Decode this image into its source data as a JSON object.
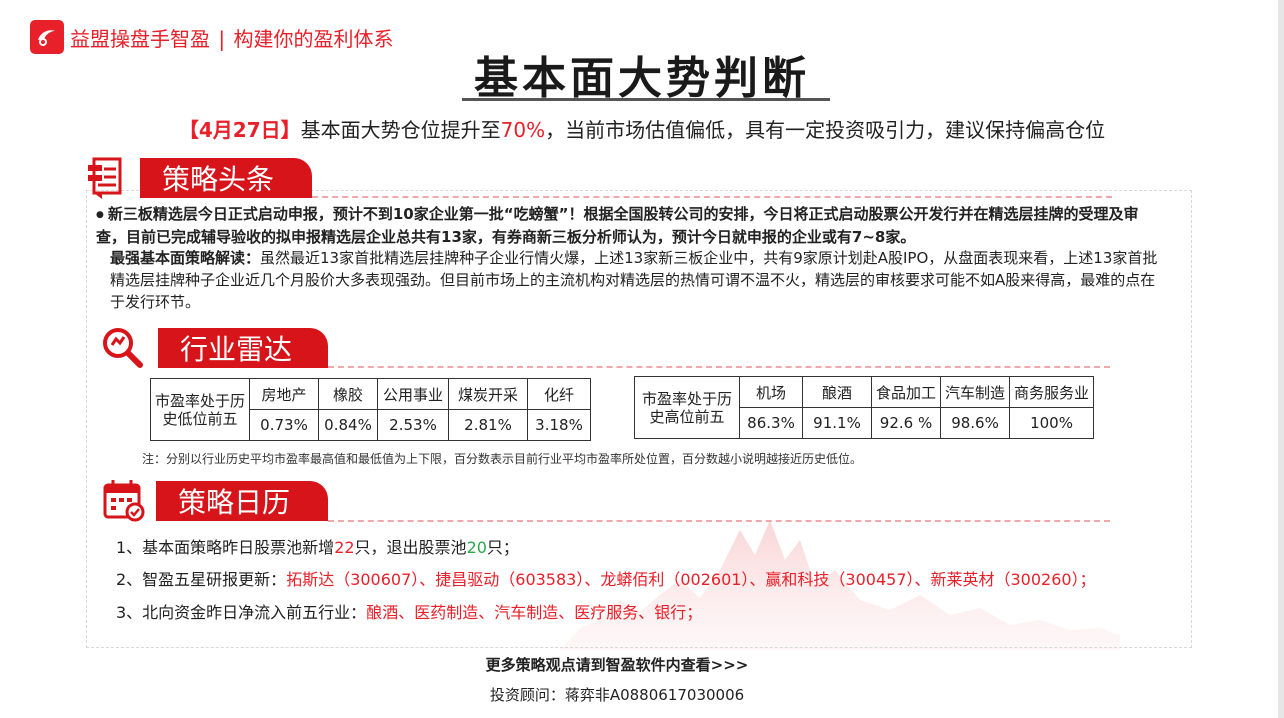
{
  "brand": {
    "name": "益盟操盘手智盈",
    "separator": "|",
    "slogan": "构建你的盈利体系",
    "color": "#e8202a"
  },
  "title": "基本面大势判断",
  "headline": {
    "date": "【4月27日】",
    "text_before": "基本面大势仓位提升至",
    "percent": "70%",
    "text_after": "，当前市场估值偏低，具有一定投资吸引力，建议保持偏高仓位"
  },
  "strategy": {
    "tab_label": "策略头条",
    "icon": "document-icon",
    "bullet": "●",
    "lead": "新三板精选层今日正式启动申报，预计不到10家企业第一批“吃螃蟹”！根据全国股转公司的安排，今日将正式启动股票公开发行并在精选层挂牌的受理及审查，目前已完成辅导验收的拟申报精选层企业总共有13家，有券商新三板分析师认为，预计今日就申报的企业或有7~8家。",
    "analysis_label": "最强基本面策略解读：",
    "analysis": "虽然最近13家首批精选层挂牌种子企业行情火爆，上述13家新三板企业中，共有9家原计划赴A股IPO，从盘面表现来看，上述13家首批精选层挂牌种子企业近几个月股价大多表现强劲。但目前市场上的主流机构对精选层的热情可谓不温不火，精选层的审核要求可能不如A股来得高，最难的点在于发行环节。"
  },
  "radar": {
    "tab_label": "行业雷达",
    "icon": "magnifier-icon",
    "low": {
      "header": "市盈率处于历史低位前五",
      "industries": [
        "房地产",
        "橡胶",
        "公用事业",
        "煤炭开采",
        "化纤"
      ],
      "values": [
        "0.73%",
        "0.84%",
        "2.53%",
        "2.81%",
        "3.18%"
      ]
    },
    "high": {
      "header": "市盈率处于历史高位前五",
      "industries": [
        "机场",
        "酿酒",
        "食品加工",
        "汽车制造",
        "商务服务业"
      ],
      "values": [
        "86.3%",
        "91.1%",
        "92.6 %",
        "98.6%",
        "100%"
      ]
    },
    "note": "注：分别以行业历史平均市盈率最高值和最低值为上下限，百分数表示目前行业平均市盈率所处位置，百分数越小说明越接近历史低位。"
  },
  "calendar": {
    "tab_label": "策略日历",
    "icon": "calendar-icon",
    "item1": {
      "prefix": "1、基本面策略昨日股票池新增",
      "added": "22",
      "mid": "只，退出股票池",
      "removed": "20",
      "suffix": "只；"
    },
    "item2": {
      "prefix": "2、智盈五星研报更新：",
      "stocks": "拓斯达（300607）、捷昌驱动（603583）、龙蟒佰利（002601）、赢和科技（300457）、新莱英材（300260）；"
    },
    "item3": {
      "prefix": "3、北向资金昨日净流入前五行业：",
      "industries": "酿酒、医药制造、汽车制造、医疗服务、银行；"
    }
  },
  "footer": {
    "more": "更多策略观点请到智盈软件内查看>>>",
    "advisor": "投资顾问：蒋弈非A0880617030006"
  },
  "colors": {
    "accent": "#d7141a",
    "green": "#2aa84a"
  }
}
